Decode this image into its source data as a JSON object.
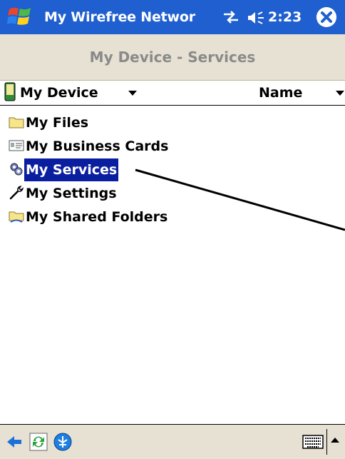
{
  "title_bar": {
    "app_title": "My Wirefree Networ",
    "clock": "2:23",
    "start_icon": "windows-flag-icon",
    "connectivity_icon": "connectivity-icon",
    "volume_icon": "speaker-icon",
    "close_icon": "close-icon"
  },
  "caption": {
    "text": "My Device - Services"
  },
  "header": {
    "location_label": "My Device",
    "sort_label": "Name"
  },
  "list": {
    "items": [
      {
        "label": "My Files",
        "icon": "folder-icon",
        "selected": false
      },
      {
        "label": "My Business Cards",
        "icon": "business-card-icon",
        "selected": false
      },
      {
        "label": "My Services",
        "icon": "services-gears-icon",
        "selected": true
      },
      {
        "label": "My Settings",
        "icon": "wrench-icon",
        "selected": false
      },
      {
        "label": "My Shared Folders",
        "icon": "shared-folder-icon",
        "selected": false
      }
    ]
  },
  "bottom_bar": {
    "icons": [
      "back-arrow-icon",
      "sync-icon",
      "network-globe-icon",
      "keyboard-icon"
    ]
  },
  "colors": {
    "title_bar": "#1f5fcf",
    "caption_bg": "#e7e1d4",
    "selection": "#0a1ea0"
  }
}
